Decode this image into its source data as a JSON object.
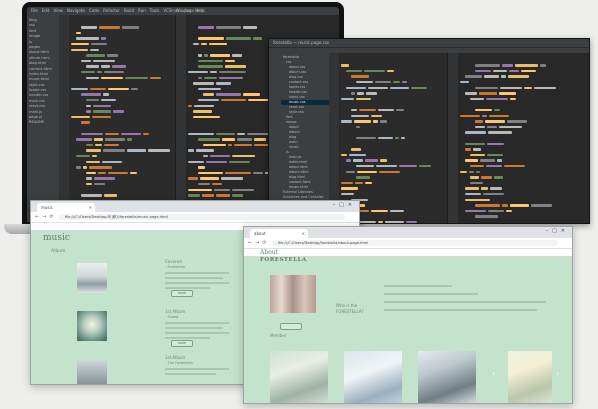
{
  "laptop_ide": {
    "menu": [
      "File",
      "Edit",
      "View",
      "Navigate",
      "Code",
      "Refactor",
      "Build",
      "Run",
      "Tools",
      "VCS",
      "Window",
      "Help"
    ],
    "title": "music.page.html",
    "tree": [
      "blog",
      "css",
      "font",
      "image",
      "js",
      "pages",
      "about.html",
      "album.html",
      "blog.html",
      "contact.html",
      "index.html",
      "music.html",
      "style.css",
      "footer.css",
      "header.css",
      "main.css",
      "reset.css",
      "main.js",
      "page.js",
      "README"
    ]
  },
  "ide2": {
    "title": "forestella — music.page.css",
    "tree": [
      "forestella",
      "css",
      "about.css",
      "album.css",
      "blog.css",
      "contact.css",
      "footer.css",
      "header.css",
      "index.css",
      "music.css",
      "reset.css",
      "style.css",
      "font",
      "image",
      "about",
      "album",
      "blog",
      "main",
      "music",
      "js",
      "main.js",
      "index.html",
      "about.html",
      "album.html",
      "blog.html",
      "contact.html",
      "music.html",
      "External Libraries",
      "Scratches and Consoles"
    ]
  },
  "browser_music": {
    "tab": "music",
    "address": "file:///C:/Users/Desktop/새 폴더/forestella/music.page.html",
    "bookmarks": [
      "앱",
      "YouTube",
      "Gmail",
      "지도",
      "번역",
      "NAVER",
      "다음",
      "Papago",
      "GitHub",
      "Notion"
    ],
    "heading": "music",
    "subheading": "Album",
    "albums": [
      {
        "title": "Covered",
        "subtitle": "- Forestella",
        "button": "more"
      },
      {
        "title": "1st Album",
        "subtitle": "- Forest",
        "button": "more"
      },
      {
        "title": "1st Album",
        "subtitle": "- The Forestella",
        "button": "more"
      }
    ]
  },
  "browser_about": {
    "tab": "about",
    "address": "file:///C:/Users/Desktop/forestella/about.page.html",
    "bookmarks": [
      "앱",
      "YouTube",
      "Gmail",
      "지도",
      "번역",
      "NAVER",
      "다음",
      "Papago",
      "GitHub"
    ],
    "heading_line1": "About",
    "heading_line2": "FORESTELLA",
    "who_label_line1": "Who is the",
    "who_label_line2": "FORESTELLA?",
    "members_label": "Member"
  },
  "colors": {
    "ide_bg": "#2b2b2b",
    "page_bg": "#c3e3cc",
    "accent_green": "#5f7f6a"
  }
}
